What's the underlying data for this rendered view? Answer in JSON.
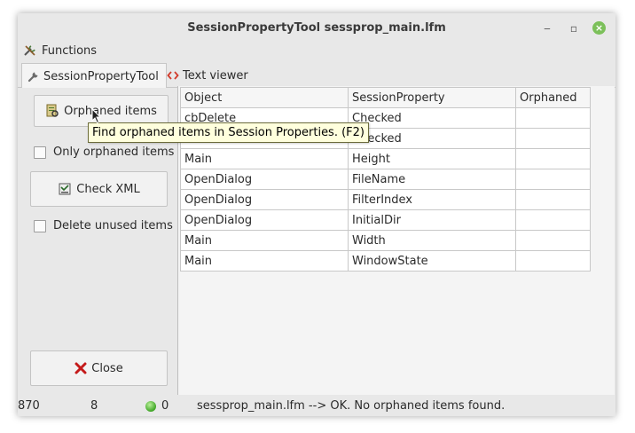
{
  "window": {
    "title": "SessionPropertyTool   sessprop_main.lfm",
    "controls": {
      "minimize": "‒",
      "maximize": "▫",
      "close": "×"
    }
  },
  "menubar": {
    "functions_label": "Functions"
  },
  "tabs": [
    {
      "label": "SessionPropertyTool",
      "icon": "wrench-icon",
      "active": true
    },
    {
      "label": "Text viewer",
      "icon": "code-icon",
      "active": false
    }
  ],
  "left_panel": {
    "orphaned_items_label": "Orphaned items",
    "only_orphaned_label": "Only orphaned items",
    "check_xml_label": "Check XML",
    "delete_unused_label": "Delete unused items",
    "close_label": "Close"
  },
  "grid": {
    "headers": [
      "Object",
      "SessionProperty",
      "Orphaned"
    ],
    "rows": [
      [
        "cbDelete",
        "Checked",
        ""
      ],
      [
        "",
        "Checked",
        ""
      ],
      [
        "Main",
        "Height",
        ""
      ],
      [
        "OpenDialog",
        "FileName",
        ""
      ],
      [
        "OpenDialog",
        "FilterIndex",
        ""
      ],
      [
        "OpenDialog",
        "InitialDir",
        ""
      ],
      [
        "Main",
        "Width",
        ""
      ],
      [
        "Main",
        "WindowState",
        ""
      ]
    ]
  },
  "tooltip": "Find orphaned items in Session Properties. (F2)",
  "statusbar": {
    "count1": "870",
    "count2": "8",
    "count3": "0",
    "message": "sessprop_main.lfm --> OK. No orphaned items found."
  },
  "colors": {
    "status_led": "#3fa526",
    "close_button": "#7cc05a",
    "tooltip_bg": "#ffffdd",
    "close_x": "#c41a1a"
  }
}
